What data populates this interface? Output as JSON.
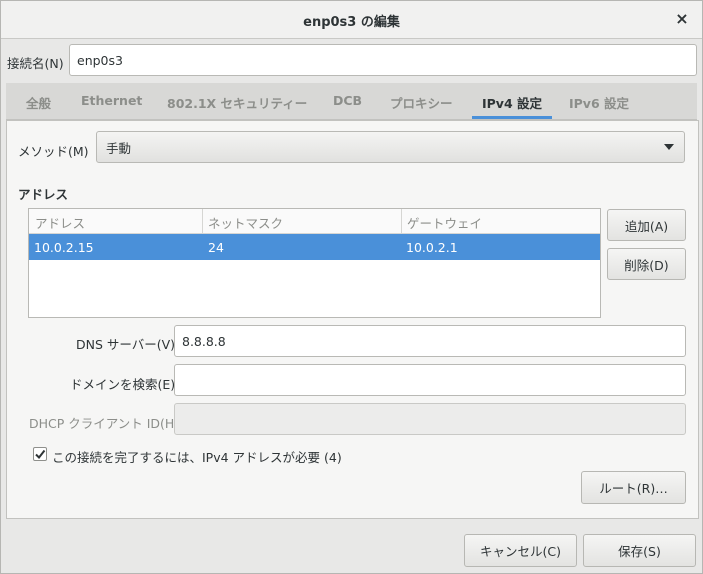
{
  "window": {
    "title": "enp0s3 の編集",
    "close_glyph": "×"
  },
  "connection_name": {
    "label": "接続名(N)",
    "value": "enp0s3"
  },
  "tabs": [
    {
      "label": "全般",
      "active": false
    },
    {
      "label": "Ethernet",
      "active": false
    },
    {
      "label": "802.1X セキュリティー",
      "active": false
    },
    {
      "label": "DCB",
      "active": false
    },
    {
      "label": "プロキシー",
      "active": false
    },
    {
      "label": "IPv4 設定",
      "active": true
    },
    {
      "label": "IPv6 設定",
      "active": false
    }
  ],
  "ipv4": {
    "method": {
      "label": "メソッド(M)",
      "value": "手動"
    },
    "addresses": {
      "section_title": "アドレス",
      "columns": [
        "アドレス",
        "ネットマスク",
        "ゲートウェイ"
      ],
      "rows": [
        {
          "address": "10.0.2.15",
          "netmask": "24",
          "gateway": "10.0.2.1",
          "selected": true
        }
      ],
      "add_button": "追加(A)",
      "delete_button": "削除(D)"
    },
    "dns": {
      "label": "DNS サーバー(V)",
      "value": "8.8.8.8"
    },
    "search_domains": {
      "label": "ドメインを検索(E)",
      "value": ""
    },
    "dhcp_client_id": {
      "label": "DHCP クライアント ID(H)",
      "value": "",
      "disabled": true
    },
    "require_ipv4": {
      "label": "この接続を完了するには、IPv4 アドレスが必要 (4)",
      "checked": true
    },
    "routes_button": "ルート(R)…"
  },
  "footer": {
    "cancel": "キャンセル(C)",
    "save": "保存(S)"
  },
  "colors": {
    "accent": "#4a90d9",
    "window_bg": "#e8e8e7",
    "panel_bg": "#f6f6f5"
  }
}
